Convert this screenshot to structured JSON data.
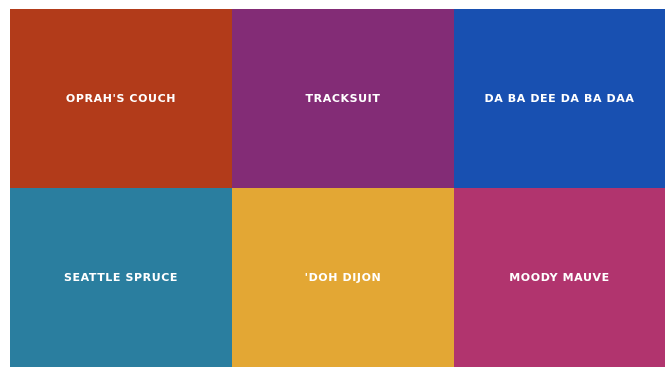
{
  "tiles": [
    {
      "label": "OPRAH'S COUCH",
      "color": "#B23B1A"
    },
    {
      "label": "TRACKSUIT",
      "color": "#832C76"
    },
    {
      "label": "DA BA DEE DA BA DAA",
      "color": "#1850B1"
    },
    {
      "label": "SEATTLE SPRUCE",
      "color": "#2A7E9F"
    },
    {
      "label": "'DOH DIJON",
      "color": "#E3A734"
    },
    {
      "label": "MOODY MAUVE",
      "color": "#B1346E"
    }
  ]
}
